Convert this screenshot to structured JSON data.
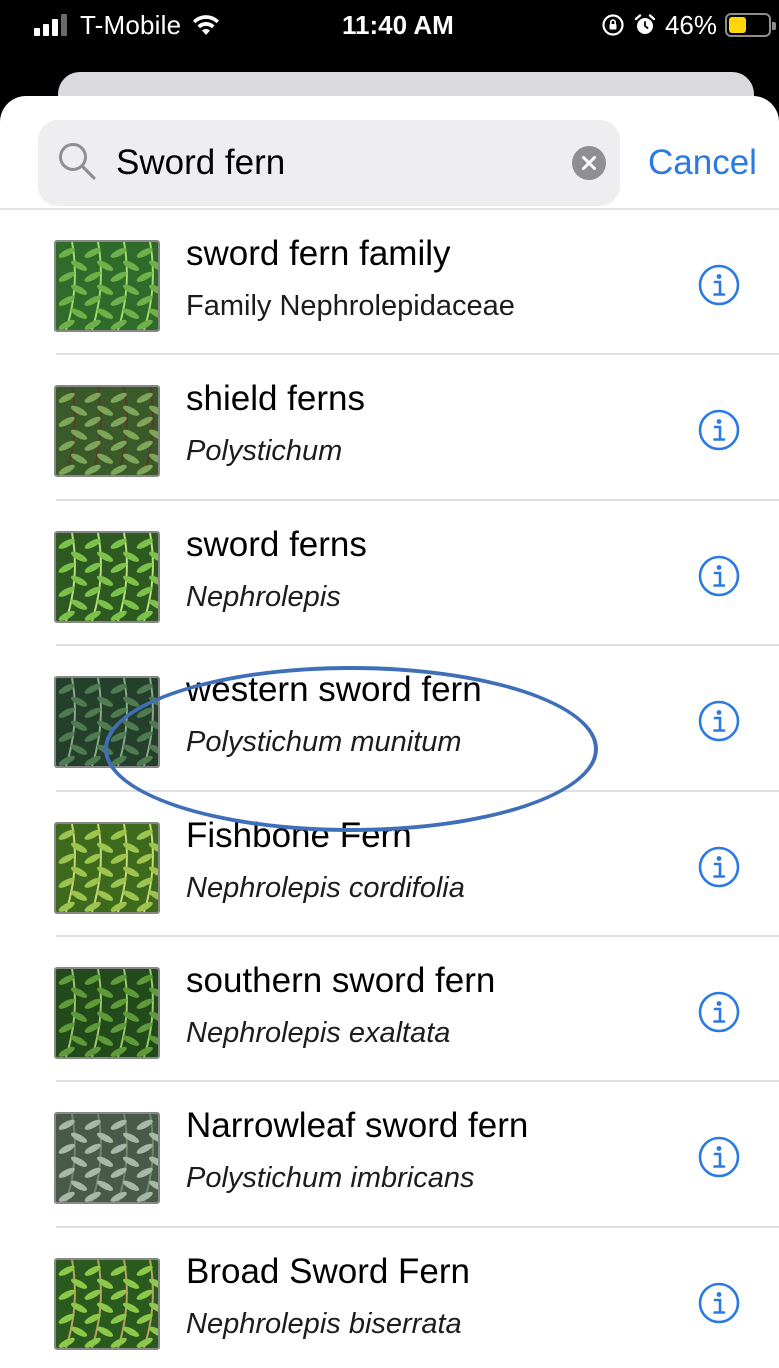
{
  "status_bar": {
    "carrier": "T-Mobile",
    "time": "11:40 AM",
    "battery_percent": "46%",
    "battery_level": 0.46,
    "battery_color": "#ffd60a"
  },
  "search": {
    "query": "Sword fern",
    "cancel_label": "Cancel"
  },
  "accent_color": "#2a7ae2",
  "results": [
    {
      "title": "sword fern family",
      "subtitle": "Family Nephrolepidaceae",
      "subtitle_italic": false
    },
    {
      "title": "shield ferns",
      "subtitle": "Polystichum",
      "subtitle_italic": true
    },
    {
      "title": "sword ferns",
      "subtitle": "Nephrolepis",
      "subtitle_italic": true
    },
    {
      "title": "western sword fern",
      "subtitle": "Polystichum munitum",
      "subtitle_italic": true,
      "highlighted": true
    },
    {
      "title": "Fishbone Fern",
      "subtitle": "Nephrolepis cordifolia",
      "subtitle_italic": true
    },
    {
      "title": "southern sword fern",
      "subtitle": "Nephrolepis exaltata",
      "subtitle_italic": true
    },
    {
      "title": "Narrowleaf sword fern",
      "subtitle": "Polystichum imbricans",
      "subtitle_italic": true
    },
    {
      "title": "Broad Sword Fern",
      "subtitle": "Nephrolepis biserrata",
      "subtitle_italic": true
    }
  ],
  "icons": {
    "search": "magnifier-icon",
    "clear": "clear-x-icon",
    "info": "info-circle-icon",
    "wifi": "wifi-icon",
    "lock": "rotation-lock-icon",
    "alarm": "alarm-icon"
  }
}
